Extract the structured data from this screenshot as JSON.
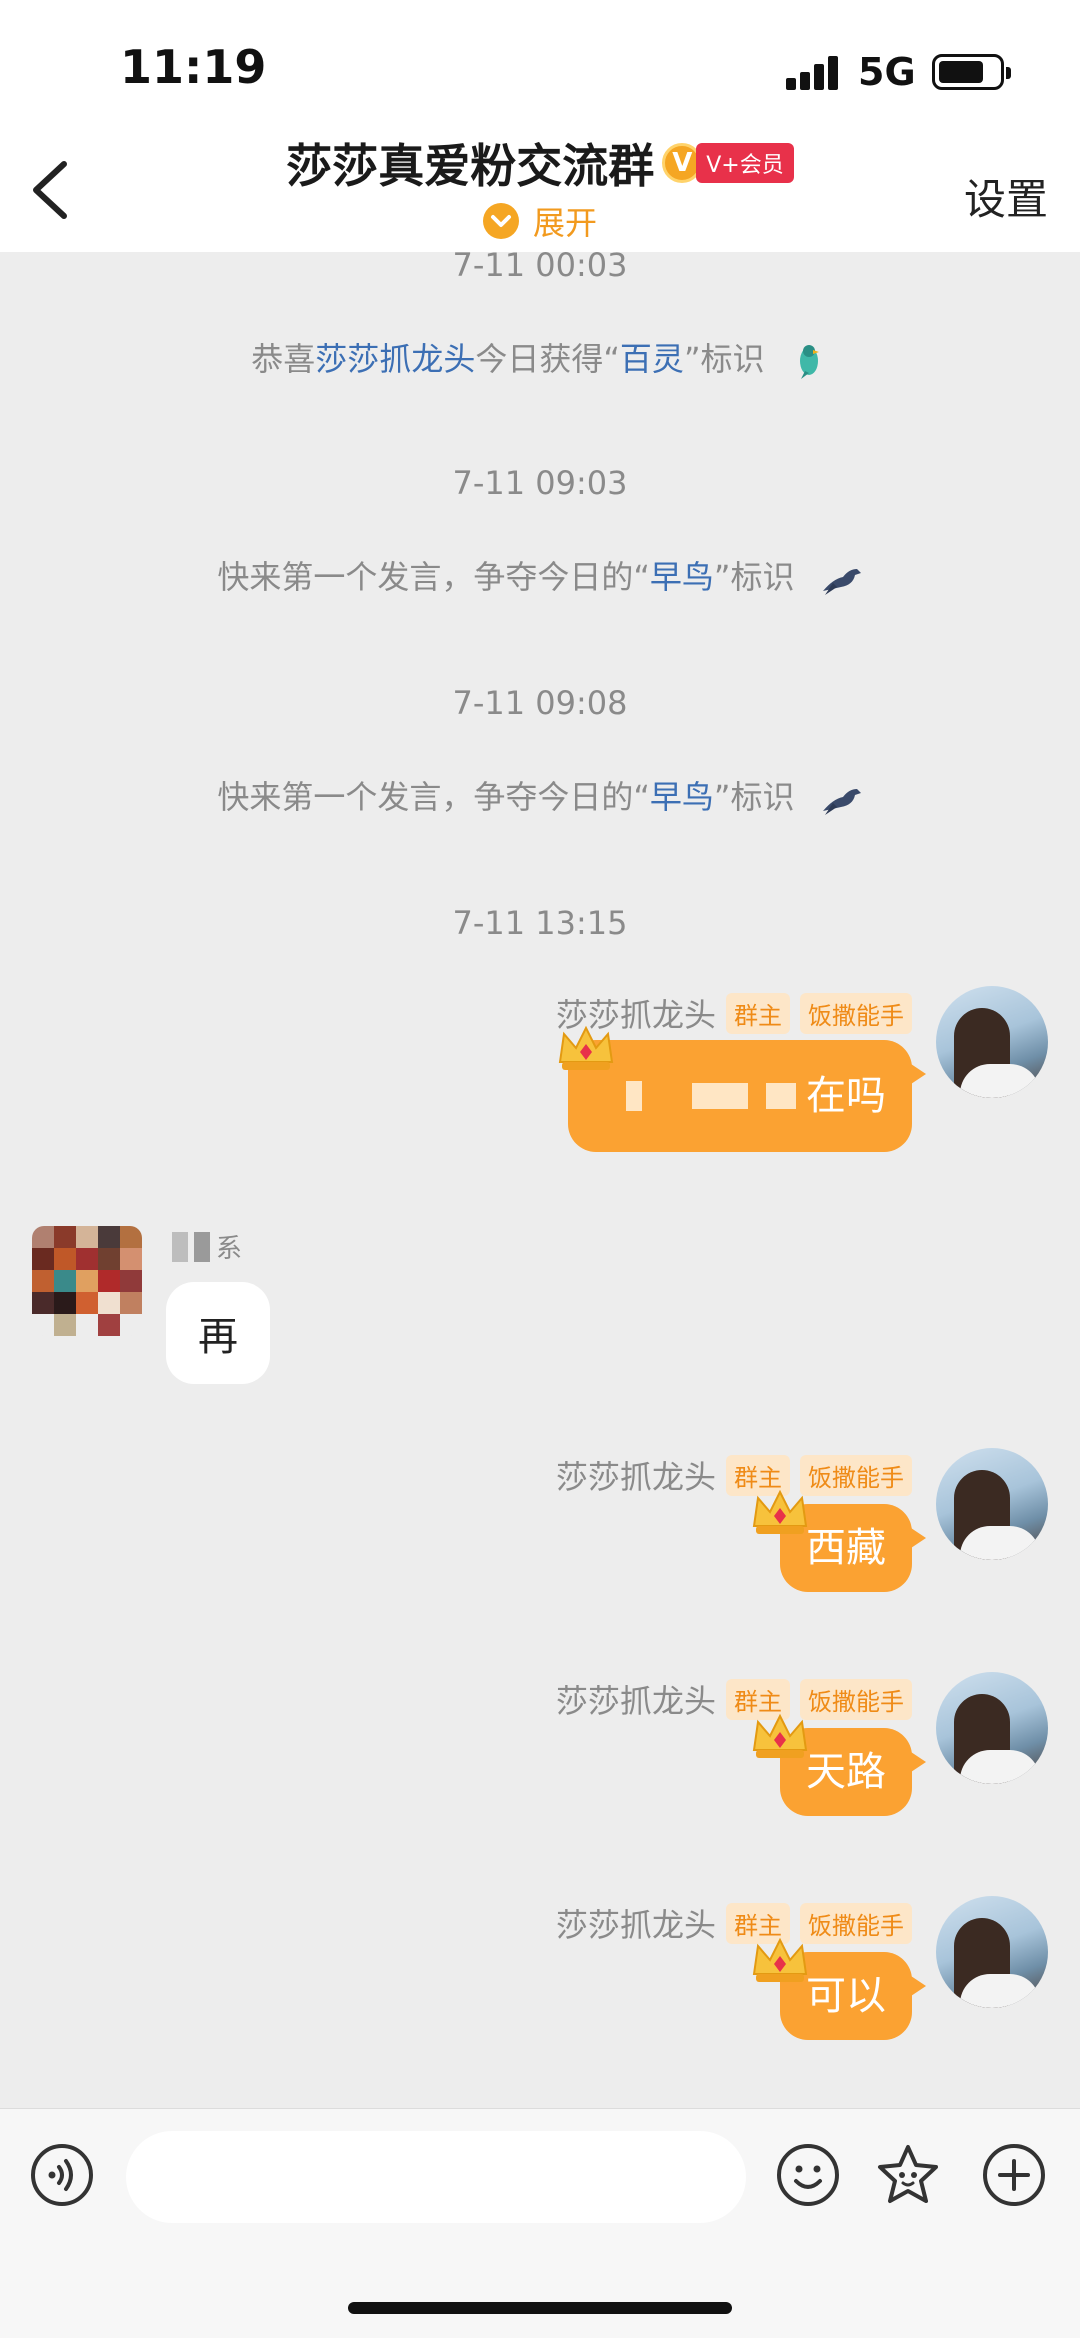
{
  "status": {
    "time": "11:19",
    "network": "5G"
  },
  "header": {
    "title": "莎莎真爱粉交流群",
    "vip_mark": "V",
    "vip_label": "V+会员",
    "expand_label": "展开",
    "settings_label": "设置"
  },
  "timestamps": [
    "7-11 00:03",
    "7-11 09:03",
    "7-11 09:08",
    "7-11 13:15"
  ],
  "system_messages": [
    {
      "prefix": "恭喜",
      "highlight1": "莎莎抓龙头",
      "mid": "今日获得“",
      "highlight2": "百灵",
      "suffix": "”标识",
      "bird": "parrot-icon"
    },
    {
      "prefix": "快来第一个发言，争夺今日的“",
      "highlight": "早鸟",
      "suffix": "”标识",
      "bird": "bird-icon"
    },
    {
      "prefix": "快来第一个发言，争夺今日的“",
      "highlight": "早鸟",
      "suffix": "”标识",
      "bird": "bird-icon"
    }
  ],
  "messages": [
    {
      "side": "right",
      "sender": "莎莎抓龙头",
      "tags": [
        "群主",
        "饭撒能手"
      ],
      "text": "在吗",
      "blurred_prefix": true
    },
    {
      "side": "left",
      "sender_blurred": true,
      "sender_suffix": "系",
      "text": "再"
    },
    {
      "side": "right",
      "sender": "莎莎抓龙头",
      "tags": [
        "群主",
        "饭撒能手"
      ],
      "text": "西藏"
    },
    {
      "side": "right",
      "sender": "莎莎抓龙头",
      "tags": [
        "群主",
        "饭撒能手"
      ],
      "text": "天路"
    },
    {
      "side": "right",
      "sender": "莎莎抓龙头",
      "tags": [
        "群主",
        "饭撒能手"
      ],
      "text": "可以"
    }
  ],
  "input": {
    "placeholder": ""
  },
  "colors": {
    "accent": "#fba232",
    "highlight": "#3c6fb4",
    "vip": "#e8314a"
  }
}
